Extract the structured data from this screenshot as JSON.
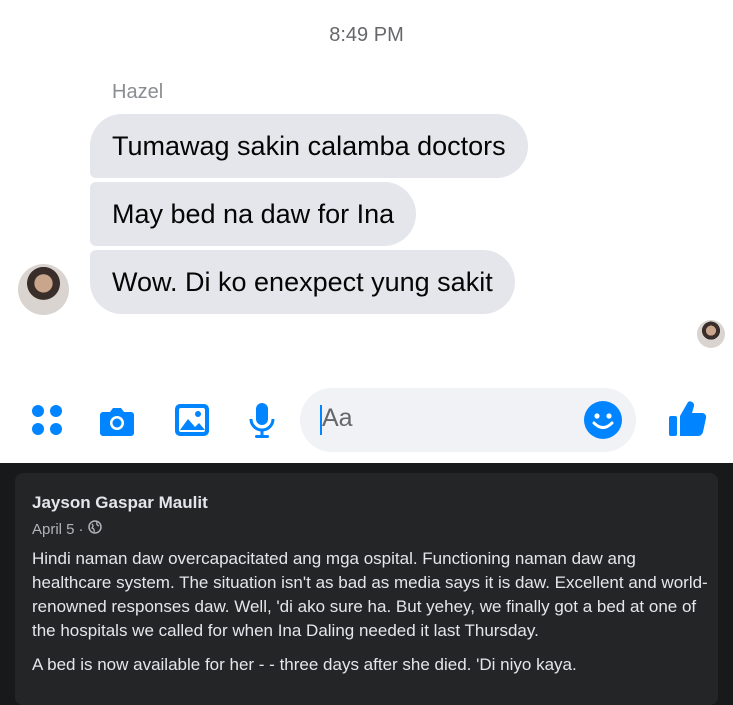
{
  "chat": {
    "timestamp": "8:49 PM",
    "sender": "Hazel",
    "messages": [
      "Tumawag sakin calamba doctors",
      "May bed na daw for Ina",
      "Wow. Di ko enexpect yung sakit"
    ]
  },
  "composer": {
    "placeholder": "Aa",
    "icons": [
      "apps-icon",
      "camera-icon",
      "gallery-icon",
      "microphone-icon",
      "emoji-icon",
      "thumbs-up-icon"
    ],
    "accent_color": "#0084ff"
  },
  "post": {
    "author": "Jayson Gaspar Maulit",
    "date": "April 5",
    "separator": "·",
    "privacy_icon": "globe-icon",
    "paragraphs": [
      "Hindi naman daw overcapacitated ang mga ospital. Functioning naman daw ang healthcare system. The situation isn't as bad as media says it is daw. Excellent and world-renowned responses daw. Well, 'di ako sure ha. But yehey, we finally got a bed at one of the hospitals we called for when Ina Daling needed it last Thursday.",
      "A bed is now available for her - - three days after she died. 'Di niyo kaya."
    ]
  }
}
